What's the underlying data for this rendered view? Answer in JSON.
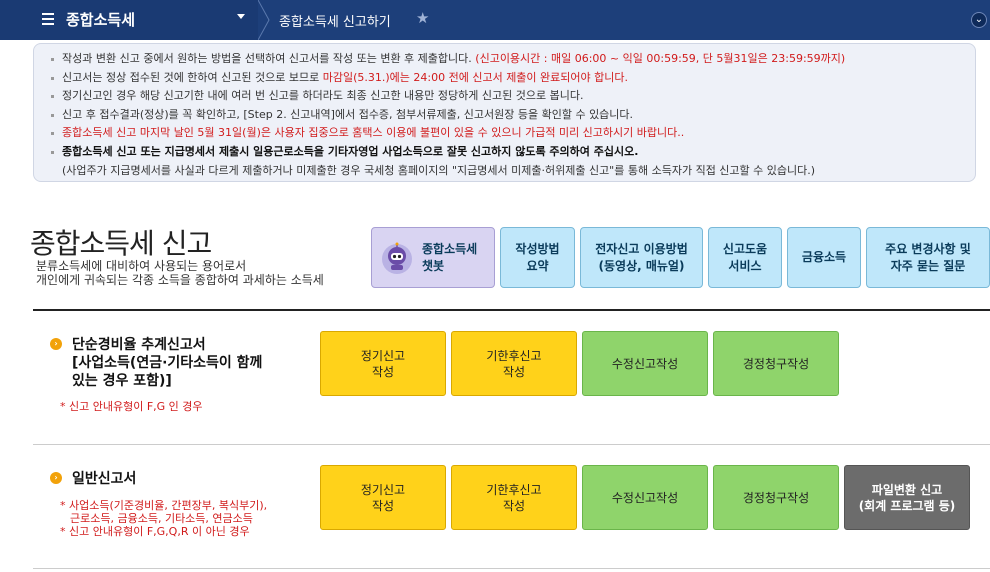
{
  "header": {
    "menu_title": "종합소득세",
    "breadcrumb": "종합소득세 신고하기"
  },
  "notice": {
    "items": [
      {
        "text": "작성과 변환 신고 중에서 원하는 방법을 선택하여 신고서를 작성 또는 변환 후 제출합니다. ",
        "red": "(신고이용시간 : 매일 06:00 ~ 익일 00:59:59, 단 5월31일은 23:59:59까지)"
      },
      {
        "text": "신고서는 정상 접수된 것에 한하여 신고된 것으로 보므로 ",
        "red": "마감일(5.31.)에는 24:00 전에 신고서 제출이 완료되어야 합니다."
      },
      {
        "text": "정기신고인 경우 해당 신고기한 내에 여러 번 신고를 하더라도 최종 신고한 내용만 정당하게 신고된 것으로 봅니다."
      },
      {
        "text": "신고 후 접수결과(정상)를 꼭 확인하고, [Step 2. 신고내역]에서 접수증, 첨부서류제출, 신고서원장 등을 확인할 수 있습니다."
      },
      {
        "red_only": "종합소득세 신고 마지막 날인 5월 31일(월)은 사용자 집중으로 홈택스 이용에 불편이 있을 수 있으니 가급적 미리 신고하시기 바랍니다.."
      },
      {
        "bold": "종합소득세 신고 또는 지급명세서 제출시 일용근로소득을 기타자영업 사업소득으로 잘못 신고하지 않도록 주의하여 주십시오."
      },
      {
        "sub": "(사업주가 지급명세서를 사실과 다르게 제출하거나 미제출한 경우 국세청 홈페이지의 \"지급명세서 미제출·허위제출 신고\"를 통해 소득자가 직접 신고할 수 있습니다.)"
      }
    ]
  },
  "page": {
    "title": "종합소득세 신고",
    "desc_line1": "분류소득세에 대비하여 사용되는 용어로서",
    "desc_line2": "개인에게 귀속되는 각종 소득을 종합하여 과세하는 소득세"
  },
  "quick_buttons": [
    {
      "line1": "종합소득세",
      "line2": "챗봇"
    },
    {
      "line1": "작성방법",
      "line2": "요약"
    },
    {
      "line1": "전자신고 이용방법",
      "line2": "(동영상, 매뉴얼)"
    },
    {
      "line1": "신고도움",
      "line2": "서비스"
    },
    {
      "line1": "금융소득",
      "line2": ""
    },
    {
      "line1": "주요 변경사항 및",
      "line2": "자주 묻는 질문"
    }
  ],
  "sections": [
    {
      "title1": "단순경비율 추계신고서",
      "title2": "[사업소득(연금·기타소득이 함께",
      "title3": "있는 경우 포함)]",
      "note1": "* 신고 안내유형이 F,G 인 경우",
      "buttons": [
        {
          "line1": "정기신고",
          "line2": "작성"
        },
        {
          "line1": "기한후신고",
          "line2": "작성"
        },
        {
          "line1": "수정신고작성",
          "line2": ""
        },
        {
          "line1": "경정청구작성",
          "line2": ""
        }
      ]
    },
    {
      "title1": "일반신고서",
      "note1": "* 사업소득(기준경비율, 간편장부, 복식부기),",
      "note2": "근로소득, 금융소득, 기타소득, 연금소득",
      "note3": "* 신고 안내유형이 F,G,Q,R 이 아닌 경우",
      "buttons": [
        {
          "line1": "정기신고",
          "line2": "작성"
        },
        {
          "line1": "기한후신고",
          "line2": "작성"
        },
        {
          "line1": "수정신고작성",
          "line2": ""
        },
        {
          "line1": "경정청구작성",
          "line2": ""
        },
        {
          "line1": "파일변환 신고",
          "line2": "(회계 프로그램 등)"
        }
      ]
    }
  ],
  "colors": {
    "topbar": "#1d3f7a",
    "yellow_button": "#ffd21a",
    "green_button": "#8fd46b",
    "gray_button": "#6c6c6c",
    "quick_button": "#bfe7fa",
    "chatbot_button": "#d9d4f2",
    "notice_red": "#d11b1b"
  }
}
